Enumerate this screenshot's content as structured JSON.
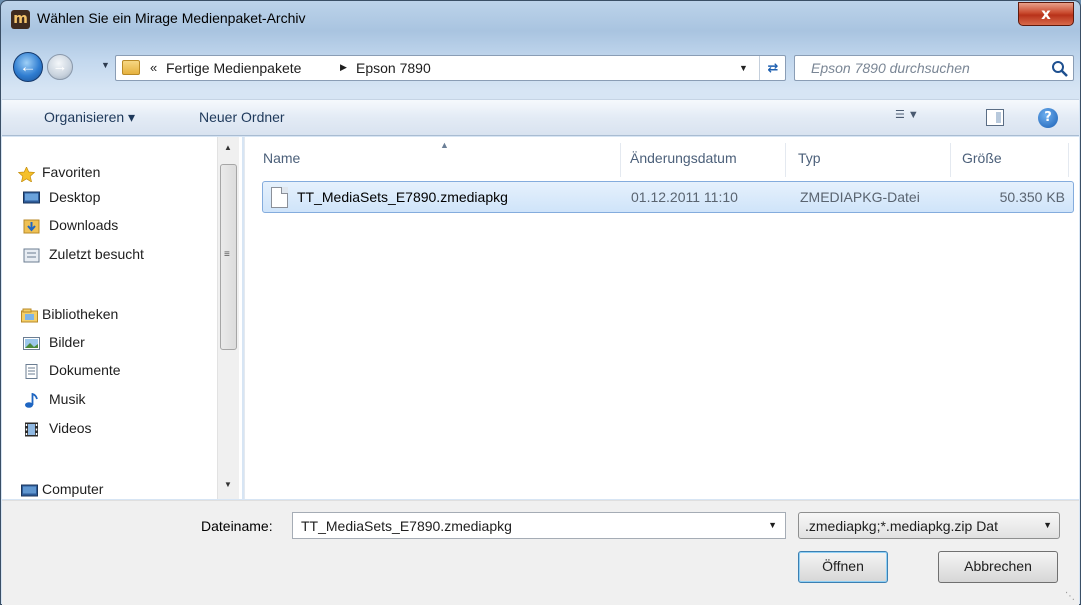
{
  "window": {
    "title": "Wählen Sie ein Mirage Medienpaket-Archiv",
    "app_icon_letter": "m",
    "close_label": "x"
  },
  "nav": {
    "breadcrumb": [
      "Fertige Medienpakete",
      "Epson 7890"
    ],
    "breadcrumb_prefix": "«",
    "search_placeholder": "Epson 7890 durchsuchen"
  },
  "toolbar": {
    "organize_label": "Organisieren ▾",
    "new_folder_label": "Neuer Ordner",
    "help_label": "?"
  },
  "sidebar": {
    "favorites_header": "Favoriten",
    "favorites": [
      "Desktop",
      "Downloads",
      "Zuletzt besucht"
    ],
    "libraries_header": "Bibliotheken",
    "libraries": [
      "Bilder",
      "Dokumente",
      "Musik",
      "Videos"
    ],
    "computer_header": "Computer"
  },
  "files": {
    "columns": [
      "Name",
      "Änderungsdatum",
      "Typ",
      "Größe"
    ],
    "rows": [
      {
        "name": "TT_MediaSets_E7890.zmediapkg",
        "date": "01.12.2011 11:10",
        "type": "ZMEDIAPKG-Datei",
        "size": "50.350 KB"
      }
    ]
  },
  "footer": {
    "filename_label": "Dateiname:",
    "filename_value": "TT_MediaSets_E7890.zmediapkg",
    "filter_value": ".zmediapkg;*.mediapkg.zip Dat",
    "open_label": "Öffnen",
    "cancel_label": "Abbrechen"
  },
  "colors": {
    "selection_border": "#84acdd",
    "selection_fill": "#cfe4fa",
    "toolbar_text": "#1e395b"
  }
}
